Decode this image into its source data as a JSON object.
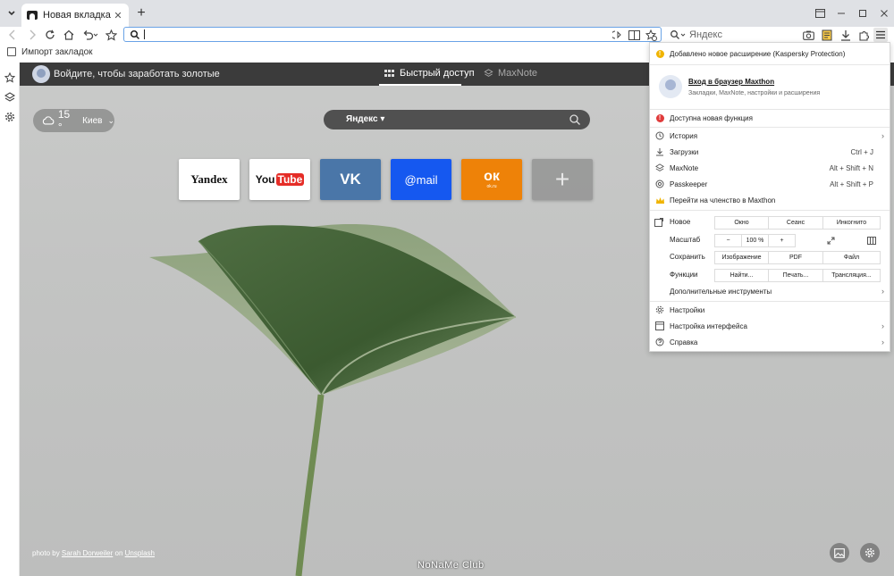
{
  "tabs": [
    {
      "title": "Новая вкладка"
    }
  ],
  "address": {
    "value": "",
    "placeholder": ""
  },
  "search": {
    "placeholder": "Яндекс"
  },
  "bookmarks": {
    "import_label": "Импорт закладок"
  },
  "page": {
    "login_prompt": "Войдите, чтобы заработать золотые",
    "tabs": [
      {
        "label": "Быстрый доступ"
      },
      {
        "label": "MaxNote"
      }
    ],
    "weather": {
      "temp": "15 °",
      "city": "Киев"
    },
    "search_engine": "Яндекс",
    "tiles": [
      {
        "label": "Yandex"
      },
      {
        "label_you": "You",
        "label_tube": "Tube"
      },
      {
        "label": "VK"
      },
      {
        "label": "@mail"
      },
      {
        "label": "ок",
        "sub": "ok.ru"
      },
      {
        "label": "+"
      }
    ],
    "photo_credit": {
      "prefix": "photo by ",
      "author": "Sarah Dorweiler",
      "mid": " on ",
      "source": "Unsplash"
    },
    "watermark": "NoNaMe Club"
  },
  "menu": {
    "notice_extension": "Добавлено новое расширение (Kaspersky Protection)",
    "login_title": "Вход в браузер Maxthon",
    "login_sub": "Закладки, MaxNote, настройки и расширения",
    "notice_feature": "Доступна новая функция",
    "items": [
      {
        "label": "История",
        "shortcut": ""
      },
      {
        "label": "Загрузки",
        "shortcut": "Ctrl + J"
      },
      {
        "label": "MaxNote",
        "shortcut": "Alt + Shift + N"
      },
      {
        "label": "Passkeeper",
        "shortcut": "Alt + Shift + P"
      },
      {
        "label": "Перейти на членство в Maxthon",
        "shortcut": ""
      }
    ],
    "new": {
      "label": "Новое",
      "buttons": [
        "Окно",
        "Сеанс",
        "Инкогнито"
      ]
    },
    "zoom": {
      "label": "Масштаб",
      "minus": "−",
      "value": "100 %",
      "plus": "+"
    },
    "save": {
      "label": "Сохранить",
      "buttons": [
        "Изображение",
        "PDF",
        "Файл"
      ]
    },
    "functions": {
      "label": "Функции",
      "buttons": [
        "Найти...",
        "Печать...",
        "Трансляция..."
      ]
    },
    "more_tools": "Дополнительные инструменты",
    "settings": "Настройки",
    "ui_settings": "Настройка интерфейса",
    "help": "Справка"
  },
  "colors": {
    "accent": "#6aa3e6",
    "vk": "#4a76a8",
    "mail": "#1558f0",
    "ok": "#ee8208",
    "youtube": "#e52d27"
  }
}
